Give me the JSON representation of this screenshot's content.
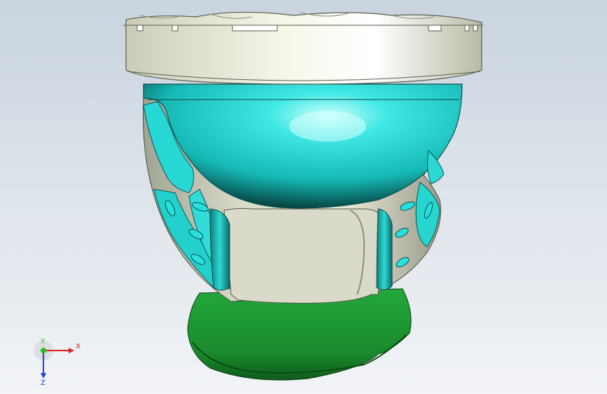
{
  "viewport": {
    "background_top": "#c8d4e0",
    "background_bottom": "#eef2f6"
  },
  "model": {
    "colors": {
      "rim": "#e8ecd8",
      "cyan": "#27e0de",
      "cyan_dark": "#0a5a58",
      "body_gray": "#c8c8b8",
      "green_base": "#1e9a32",
      "green_dark": "#0e5a18"
    }
  },
  "triad": {
    "x_label": "X",
    "y_label": "Y",
    "z_label": "Z",
    "x_color": "#e02020",
    "y_color": "#20c020",
    "z_color": "#2040e0"
  }
}
